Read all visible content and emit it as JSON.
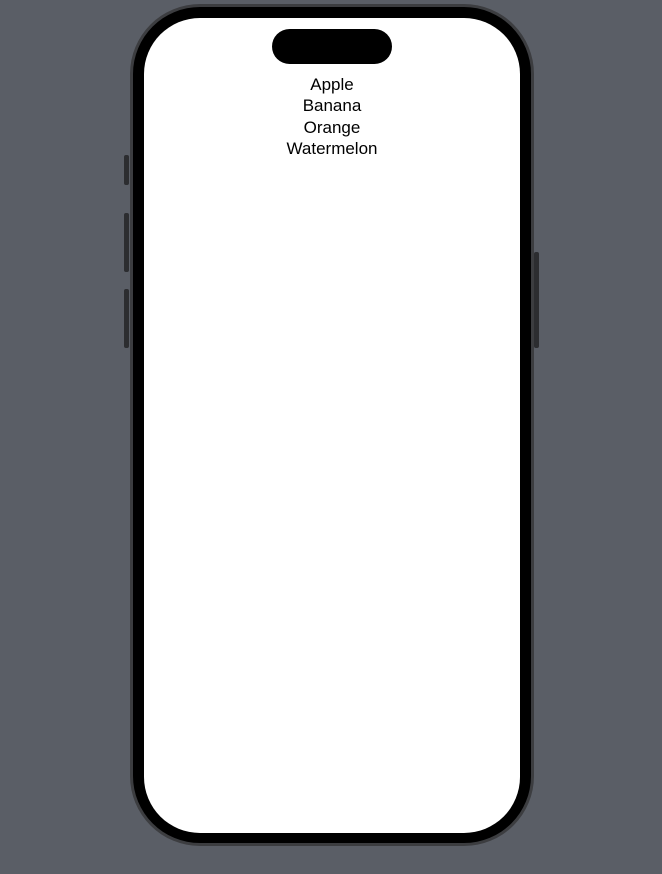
{
  "fruits": [
    {
      "label": "Apple"
    },
    {
      "label": "Banana"
    },
    {
      "label": "Orange"
    },
    {
      "label": "Watermelon"
    }
  ]
}
